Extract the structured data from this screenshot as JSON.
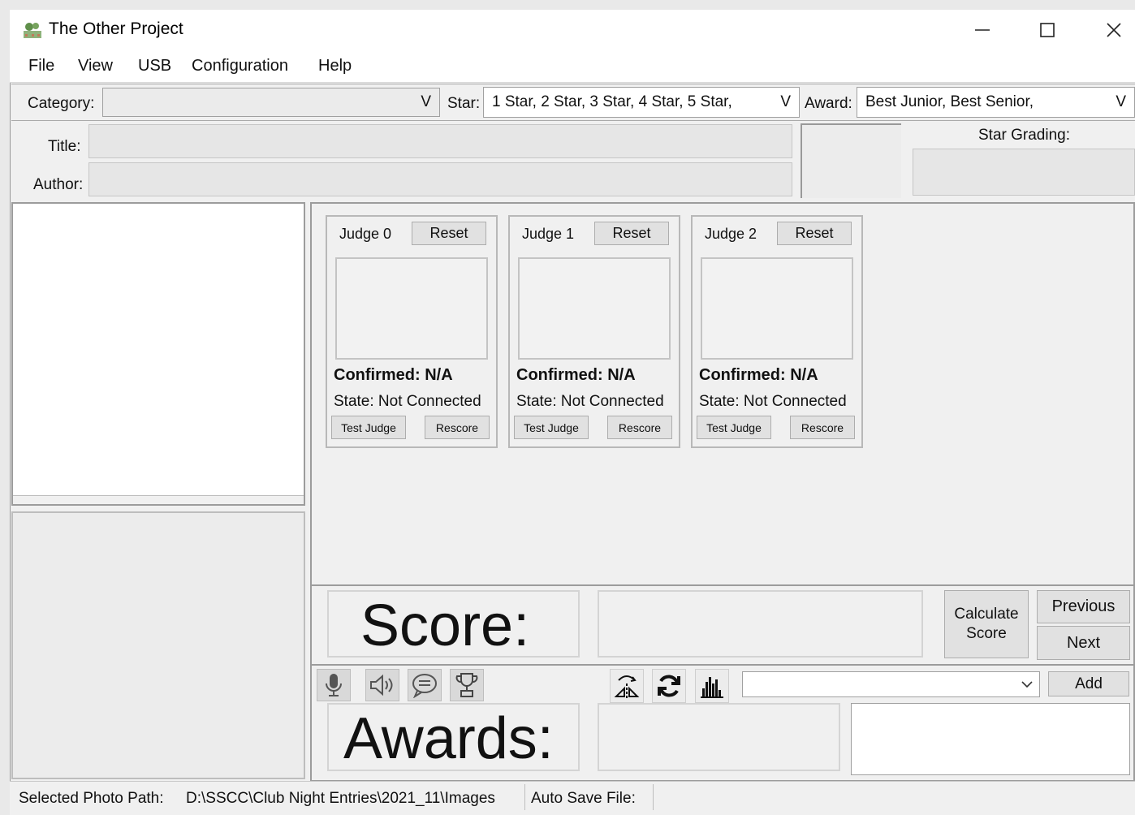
{
  "window": {
    "title": "The Other Project",
    "minimize_glyph": "—",
    "maximize_glyph": "☐",
    "close_glyph": "✕"
  },
  "menu": [
    "File",
    "View",
    "USB",
    "Configuration",
    "Help"
  ],
  "filters": {
    "category_label": "Category:",
    "category_value": "",
    "star_label": "Star:",
    "star_value": "1 Star, 2 Star, 3 Star, 4 Star, 5 Star,",
    "award_label": "Award:",
    "award_value": "Best Junior, Best Senior,",
    "dropdown_glyph": "V"
  },
  "details": {
    "title_label": "Title:",
    "title_value": "",
    "author_label": "Author:",
    "author_value": "",
    "star_grading_label": "Star Grading:"
  },
  "judges": [
    {
      "name": "Judge 0",
      "reset": "Reset",
      "confirmed": "Confirmed:  N/A",
      "state": "State:  Not Connected",
      "test": "Test Judge",
      "rescore": "Rescore"
    },
    {
      "name": "Judge 1",
      "reset": "Reset",
      "confirmed": "Confirmed:  N/A",
      "state": "State:  Not Connected",
      "test": "Test Judge",
      "rescore": "Rescore"
    },
    {
      "name": "Judge 2",
      "reset": "Reset",
      "confirmed": "Confirmed:  N/A",
      "state": "State:  Not Connected",
      "test": "Test Judge",
      "rescore": "Rescore"
    }
  ],
  "score": {
    "label": "Score:",
    "calculate": "Calculate Score",
    "previous": "Previous",
    "next": "Next"
  },
  "awards": {
    "label": "Awards:",
    "add": "Add",
    "select_value": ""
  },
  "icons": [
    "microphone-icon",
    "speaker-icon",
    "chat-icon",
    "trophy-icon",
    "flip-icon",
    "refresh-icon",
    "histogram-icon"
  ],
  "status": {
    "photo_path_label": "Selected Photo Path:",
    "photo_path_value": "D:\\SSCC\\Club Night Entries\\2021_11\\Images",
    "autosave_label": "Auto Save File:"
  }
}
